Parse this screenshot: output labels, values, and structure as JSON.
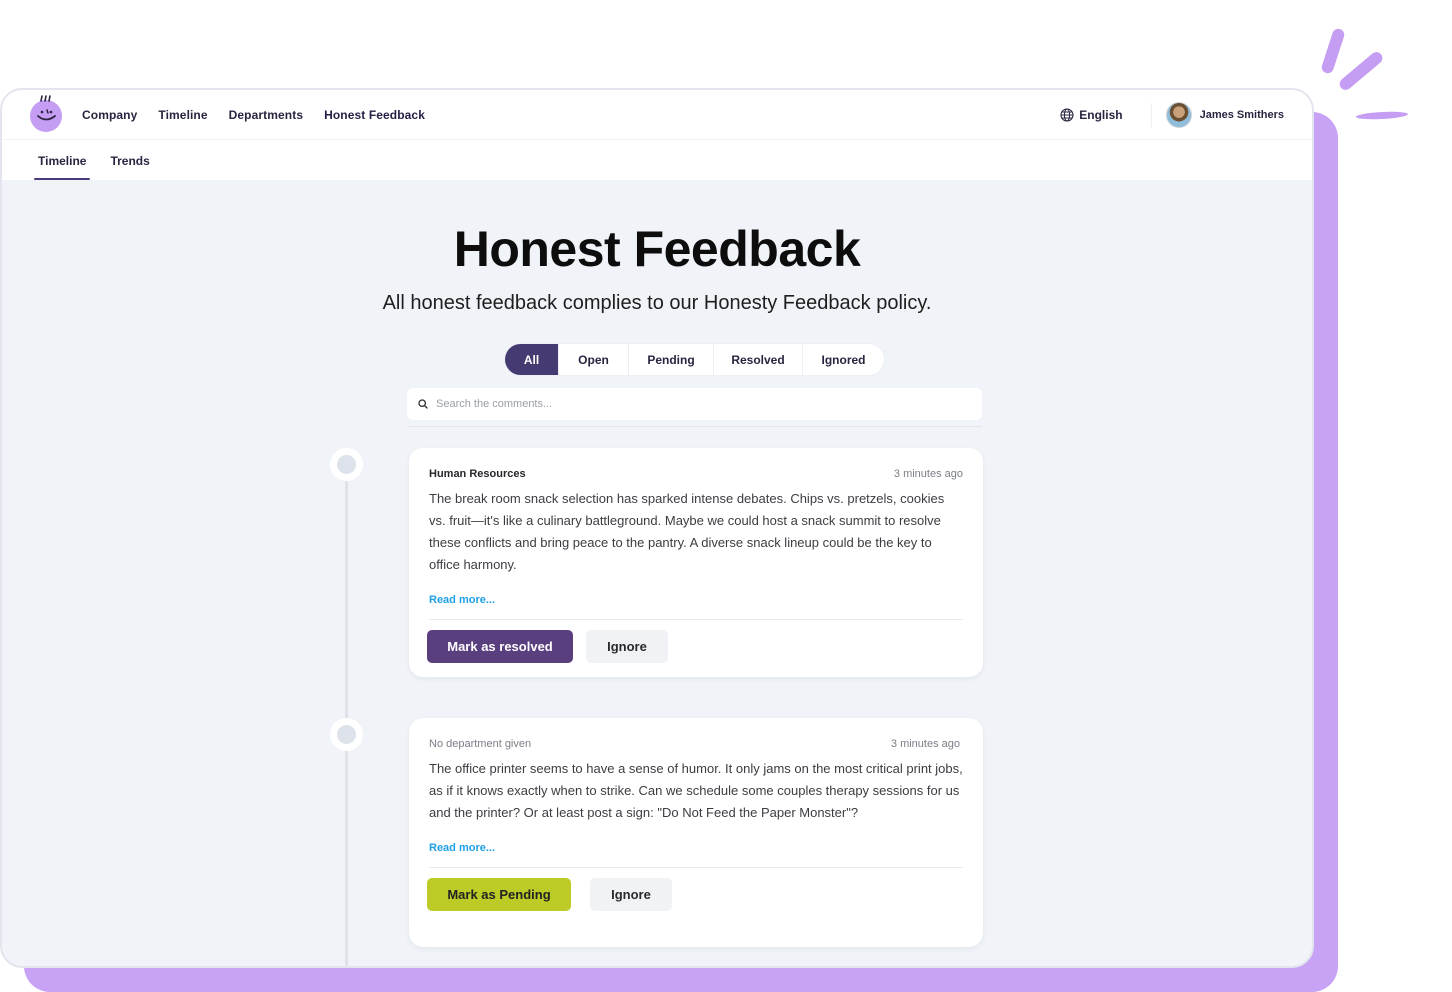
{
  "nav": {
    "logo": "smiley-logo",
    "links": [
      "Company",
      "Timeline",
      "Departments",
      "Honest Feedback"
    ],
    "active_link": "Honest Feedback",
    "language": "English",
    "user_name": "James Smithers"
  },
  "subnav": {
    "tabs": [
      "Timeline",
      "Trends"
    ],
    "active_tab": "Timeline"
  },
  "page": {
    "title": "Honest Feedback",
    "subtitle": "All honest feedback complies to our Honesty Feedback policy."
  },
  "filters": {
    "options": [
      "All",
      "Open",
      "Pending",
      "Resolved",
      "Ignored"
    ],
    "selected": "All"
  },
  "search": {
    "placeholder": "Search the comments...",
    "value": ""
  },
  "feedback": [
    {
      "department": "Human Resources",
      "time": "3 minutes ago",
      "body": "The break room snack selection has sparked intense debates. Chips vs. pretzels, cookies vs. fruit—it's like a culinary battleground. Maybe we could host a snack summit to resolve these conflicts and bring peace to the pantry. A diverse snack lineup could be the key to office harmony.",
      "read_more": "Read more...",
      "primary_action": "Mark as resolved",
      "secondary_action": "Ignore"
    },
    {
      "department": "No department given",
      "time": "3 minutes ago",
      "body": "The office printer seems to have a sense of humor. It only jams on the most critical print jobs, as if it knows exactly when to strike. Can we schedule some couples therapy sessions for us and the printer? Or at least post a sign: \"Do Not Feed the Paper Monster\"?",
      "read_more": "Read more...",
      "primary_action": "Mark as Pending",
      "secondary_action": "Ignore"
    }
  ],
  "colors": {
    "brand_purple": "#463a72",
    "resolve_button": "#5a3f7f",
    "pending_button": "#bdcb26",
    "accent_lavender": "#c7a2f5",
    "link_blue": "#1fa0e6",
    "page_bg": "#f0f4f8"
  }
}
